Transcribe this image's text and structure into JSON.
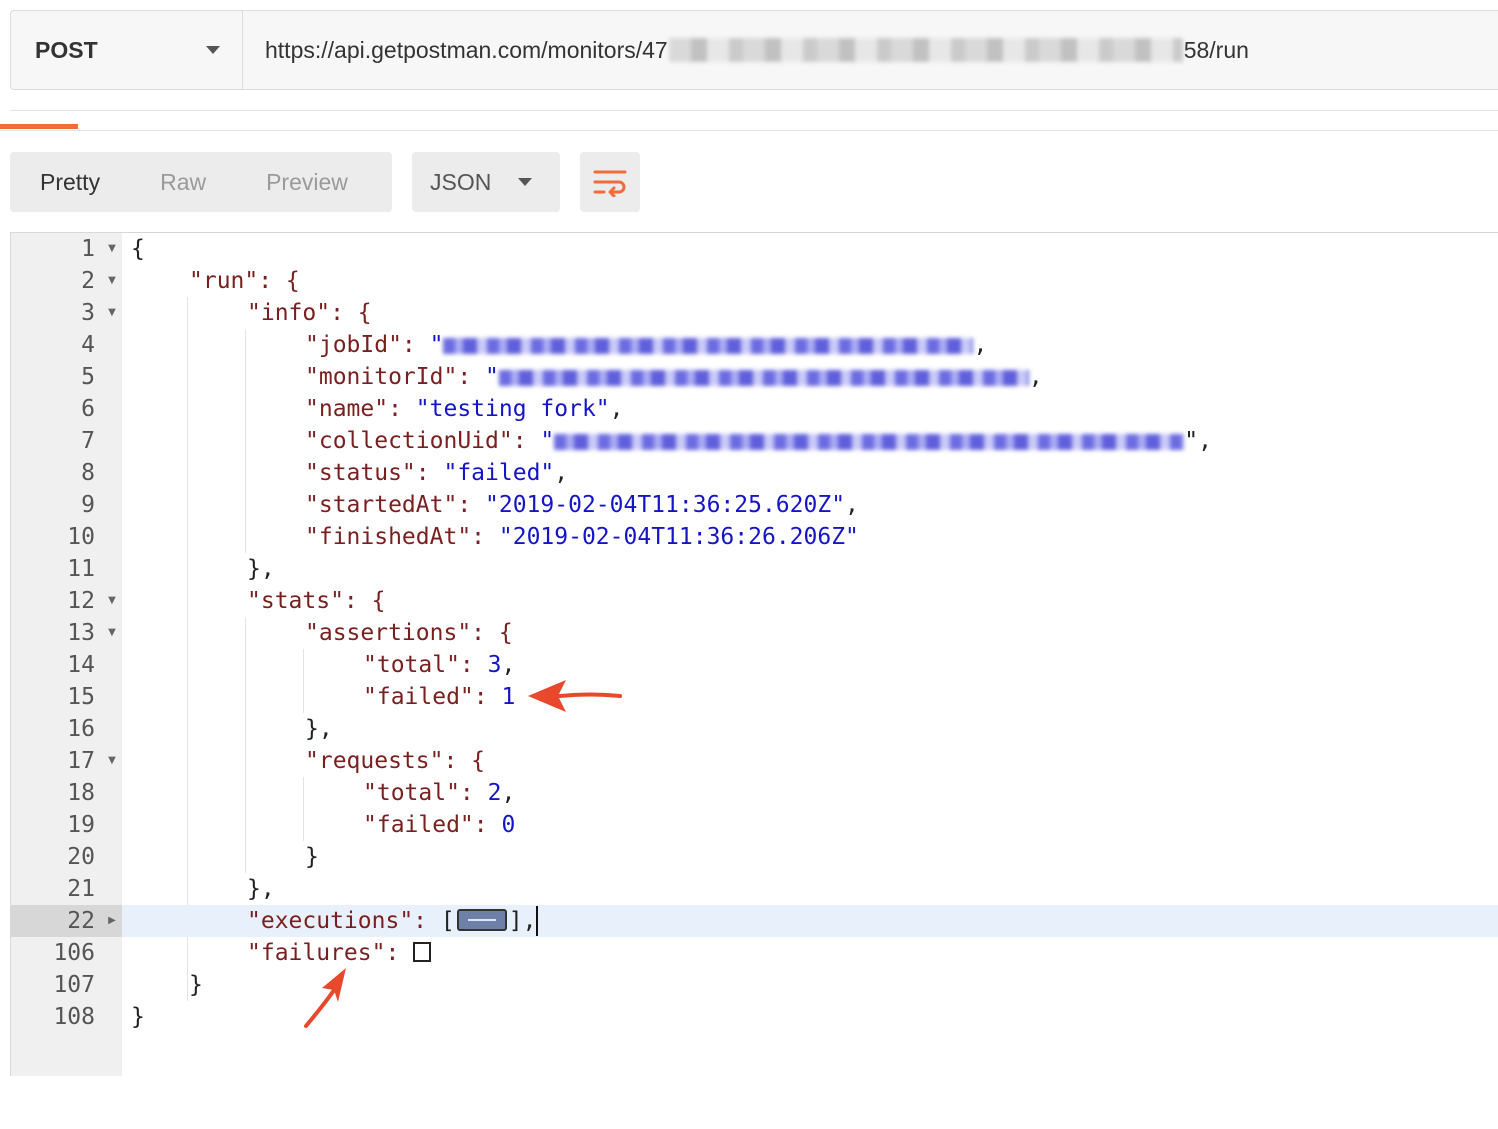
{
  "request": {
    "method": "POST",
    "url_start": "https://api.getpostman.com/monitors/47",
    "url_end": "58/run"
  },
  "view_tabs": [
    "Pretty",
    "Raw",
    "Preview"
  ],
  "format": "JSON",
  "icons": {
    "dropdown": "chevron-down-icon",
    "wrap": "wrap-lines-icon",
    "fold_open": "fold-open-icon",
    "fold_closed": "fold-closed-icon",
    "annotation": "red-arrow-icon"
  },
  "colors": {
    "accent": "#f26b3a",
    "annotation": "#e8482c",
    "key": "#7a1f1f",
    "value": "#1515c8"
  },
  "code": {
    "l1": "{",
    "l2": "\"run\": {",
    "l3": "\"info\": {",
    "l4_key": "\"jobId\": ",
    "l4_q": "\"",
    "l4_end": ",",
    "l5_key": "\"monitorId\": ",
    "l5_q": "\"",
    "l5_end": ",",
    "l6_key": "\"name\": ",
    "l6_val": "\"testing fork\"",
    "l6_end": ",",
    "l7_key": "\"collectionUid\": ",
    "l7_q": "\"",
    "l7_end": "\",",
    "l8_key": "\"status\": ",
    "l8_val": "\"failed\"",
    "l8_end": ",",
    "l9_key": "\"startedAt\": ",
    "l9_val": "\"2019-02-04T11:36:25.620Z\"",
    "l9_end": ",",
    "l10_key": "\"finishedAt\": ",
    "l10_val": "\"2019-02-04T11:36:26.206Z\"",
    "l11": "},",
    "l12": "\"stats\": {",
    "l13": "\"assertions\": {",
    "l14_key": "\"total\": ",
    "l14_val": "3",
    "l14_end": ",",
    "l15_key": "\"failed\": ",
    "l15_val": "1",
    "l16": "},",
    "l17": "\"requests\": {",
    "l18_key": "\"total\": ",
    "l18_val": "2",
    "l18_end": ",",
    "l19_key": "\"failed\": ",
    "l19_val": "0",
    "l20": "}",
    "l21": "},",
    "l22_key": "\"executions\": ",
    "l22_open": "[",
    "l22_close": "],",
    "l106_key": "\"failures\": ",
    "l107": "}",
    "l108": "}"
  },
  "line_numbers": [
    "1",
    "2",
    "3",
    "4",
    "5",
    "6",
    "7",
    "8",
    "9",
    "10",
    "11",
    "12",
    "13",
    "14",
    "15",
    "16",
    "17",
    "18",
    "19",
    "20",
    "21",
    "22",
    "106",
    "107",
    "108"
  ]
}
